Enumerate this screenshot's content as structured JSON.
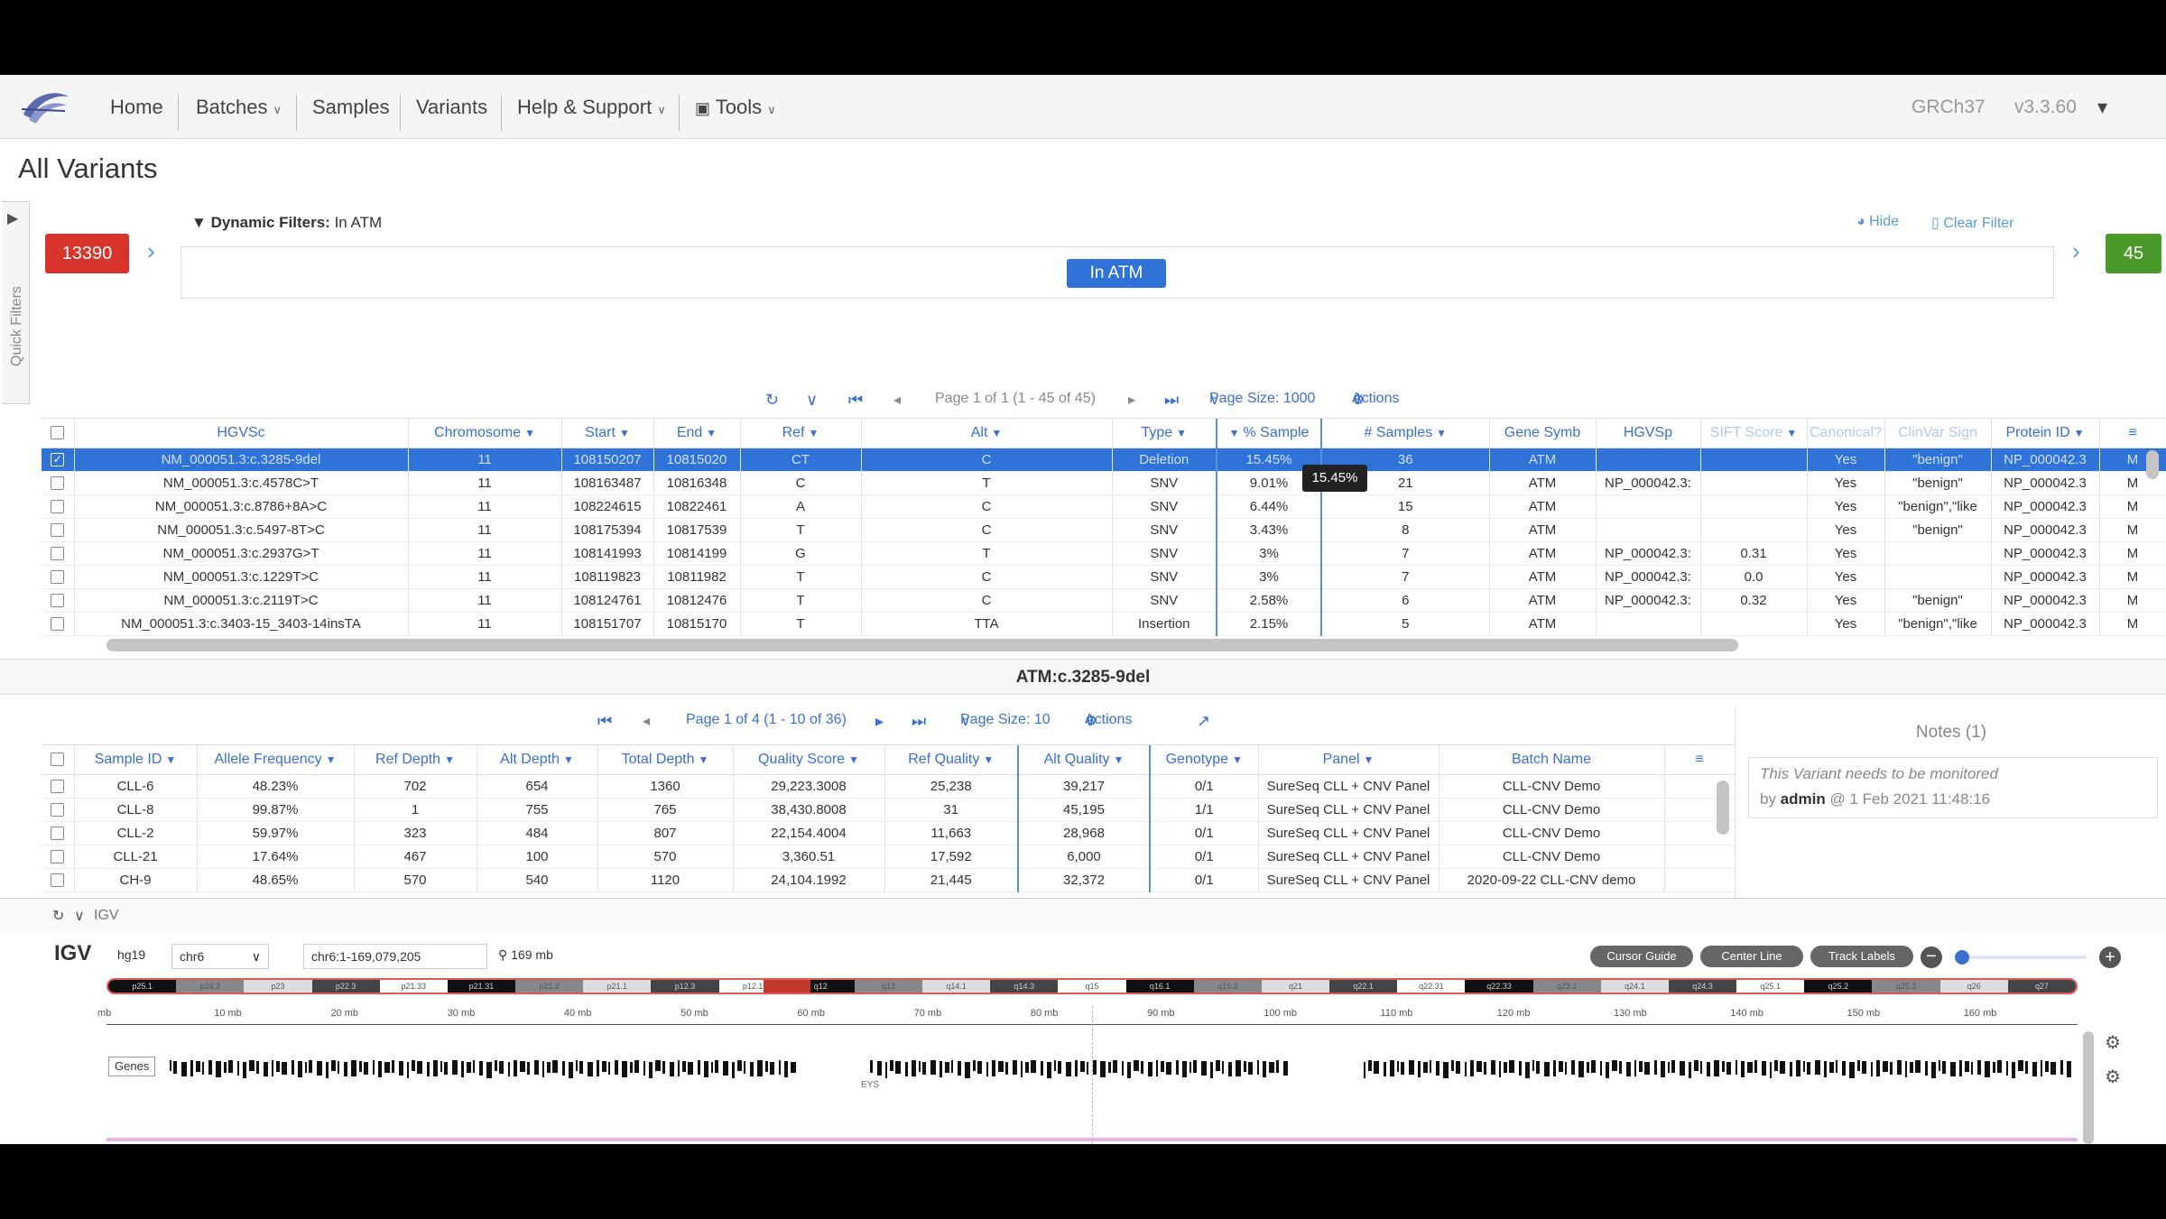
{
  "nav": {
    "home": "Home",
    "batches": "Batches",
    "samples": "Samples",
    "variants": "Variants",
    "help": "Help & Support",
    "tools": "Tools",
    "genome": "GRCh37",
    "version": "v3.3.60"
  },
  "page_title": "All Variants",
  "quick_filters_label": "Quick Filters",
  "filters": {
    "left_count": "13390",
    "right_count": "45",
    "label": "Dynamic Filters:",
    "value": "In ATM",
    "chip": "In ATM",
    "hide": "Hide",
    "clear": "Clear Filter"
  },
  "variants_pager": {
    "page_info": "Page 1 of 1 (1 - 45 of 45)",
    "page_size": "Page Size: 1000",
    "actions": "Actions"
  },
  "variants_grid": {
    "columns": [
      "HGVSc",
      "Chromosome",
      "Start",
      "End",
      "Ref",
      "Alt",
      "Type",
      "% Sample",
      "# Samples",
      "Gene Symb",
      "HGVSp",
      "SIFT Score",
      "Canonical?",
      "ClinVar Sign",
      "Protein ID"
    ],
    "rows": [
      [
        "NM_000051.3:c.3285-9del",
        "11",
        "108150207",
        "10815020",
        "CT",
        "C",
        "Deletion",
        "15.45%",
        "36",
        "ATM",
        "",
        "",
        "Yes",
        "\"benign\"",
        "NP_000042.3",
        "M"
      ],
      [
        "NM_000051.3:c.4578C>T",
        "11",
        "108163487",
        "10816348",
        "C",
        "T",
        "SNV",
        "9.01%",
        "21",
        "ATM",
        "NP_000042.3:",
        "",
        "Yes",
        "\"benign\"",
        "NP_000042.3",
        "M"
      ],
      [
        "NM_000051.3:c.8786+8A>C",
        "11",
        "108224615",
        "10822461",
        "A",
        "C",
        "SNV",
        "6.44%",
        "15",
        "ATM",
        "",
        "",
        "Yes",
        "\"benign\",\"like",
        "NP_000042.3",
        "M"
      ],
      [
        "NM_000051.3:c.5497-8T>C",
        "11",
        "108175394",
        "10817539",
        "T",
        "C",
        "SNV",
        "3.43%",
        "8",
        "ATM",
        "",
        "",
        "Yes",
        "\"benign\"",
        "NP_000042.3",
        "M"
      ],
      [
        "NM_000051.3:c.2937G>T",
        "11",
        "108141993",
        "10814199",
        "G",
        "T",
        "SNV",
        "3%",
        "7",
        "ATM",
        "NP_000042.3:",
        "0.31",
        "Yes",
        "",
        "NP_000042.3",
        "M"
      ],
      [
        "NM_000051.3:c.1229T>C",
        "11",
        "108119823",
        "10811982",
        "T",
        "C",
        "SNV",
        "3%",
        "7",
        "ATM",
        "NP_000042.3:",
        "0.0",
        "Yes",
        "",
        "NP_000042.3",
        "M"
      ],
      [
        "NM_000051.3:c.2119T>C",
        "11",
        "108124761",
        "10812476",
        "T",
        "C",
        "SNV",
        "2.58%",
        "6",
        "ATM",
        "NP_000042.3:",
        "0.32",
        "Yes",
        "\"benign\"",
        "NP_000042.3",
        "M"
      ],
      [
        "NM_000051.3:c.3403-15_3403-14insTA",
        "11",
        "108151707",
        "10815170",
        "T",
        "TTA",
        "Insertion",
        "2.15%",
        "5",
        "ATM",
        "",
        "",
        "Yes",
        "\"benign\",\"like",
        "NP_000042.3",
        "M"
      ]
    ]
  },
  "tooltip": "15.45%",
  "detail_title": "ATM:c.3285-9del",
  "samples_pager": {
    "page_info": "Page 1 of 4 (1 - 10 of 36)",
    "page_size": "Page Size: 10",
    "actions": "Actions"
  },
  "samples_grid": {
    "columns": [
      "Sample ID",
      "Allele Frequency",
      "Ref Depth",
      "Alt Depth",
      "Total Depth",
      "Quality Score",
      "Ref Quality",
      "Alt Quality",
      "Genotype",
      "Panel",
      "Batch Name"
    ],
    "rows": [
      [
        "CLL-6",
        "48.23%",
        "702",
        "654",
        "1360",
        "29,223.3008",
        "25,238",
        "39,217",
        "0/1",
        "SureSeq CLL + CNV Panel",
        "CLL-CNV Demo"
      ],
      [
        "CLL-8",
        "99.87%",
        "1",
        "755",
        "765",
        "38,430.8008",
        "31",
        "45,195",
        "1/1",
        "SureSeq CLL + CNV Panel",
        "CLL-CNV Demo"
      ],
      [
        "CLL-2",
        "59.97%",
        "323",
        "484",
        "807",
        "22,154.4004",
        "11,663",
        "28,968",
        "0/1",
        "SureSeq CLL + CNV Panel",
        "CLL-CNV Demo"
      ],
      [
        "CLL-21",
        "17.64%",
        "467",
        "100",
        "570",
        "3,360.51",
        "17,592",
        "6,000",
        "0/1",
        "SureSeq CLL + CNV Panel",
        "CLL-CNV Demo"
      ],
      [
        "CH-9",
        "48.65%",
        "570",
        "540",
        "1120",
        "24,104.1992",
        "21,445",
        "32,372",
        "0/1",
        "SureSeq CLL + CNV Panel",
        "2020-09-22 CLL-CNV demo"
      ]
    ]
  },
  "notes": {
    "title": "Notes (1)",
    "text": "This Variant needs to be monitored",
    "by": "by",
    "author": "admin",
    "when": "@ 1 Feb 2021 11:48:16"
  },
  "igv": {
    "section_label": "IGV",
    "logo": "IGV",
    "genome": "hg19",
    "chrom": "chr6",
    "locus": "chr6:1-169,079,205",
    "span": "169 mb",
    "buttons": [
      "Cursor Guide",
      "Center Line",
      "Track Labels"
    ],
    "bands": [
      "p25.1",
      "p24.3",
      "p23",
      "p22.3",
      "p21.33",
      "p21.31",
      "p21.2",
      "p21.1",
      "p12.3",
      "p12.1",
      "q12",
      "q13",
      "q14.1",
      "q14.3",
      "q15",
      "q16.1",
      "q16.3",
      "q21",
      "q22.1",
      "q22.31",
      "q22.33",
      "q23.2",
      "q24.1",
      "q24.3",
      "q25.1",
      "q25.2",
      "q25.3",
      "q26",
      "q27"
    ],
    "ruler": [
      "mb",
      "10 mb",
      "20 mb",
      "30 mb",
      "40 mb",
      "50 mb",
      "60 mb",
      "70 mb",
      "80 mb",
      "90 mb",
      "100 mb",
      "110 mb",
      "120 mb",
      "130 mb",
      "140 mb",
      "150 mb",
      "160 mb"
    ],
    "genes_label": "Genes",
    "gene_tag": "EYS"
  },
  "colors": {
    "accent": "#2f73d9",
    "red_badge": "#d9342b",
    "green_badge": "#4a9a2a",
    "link": "#3b6fd0"
  }
}
